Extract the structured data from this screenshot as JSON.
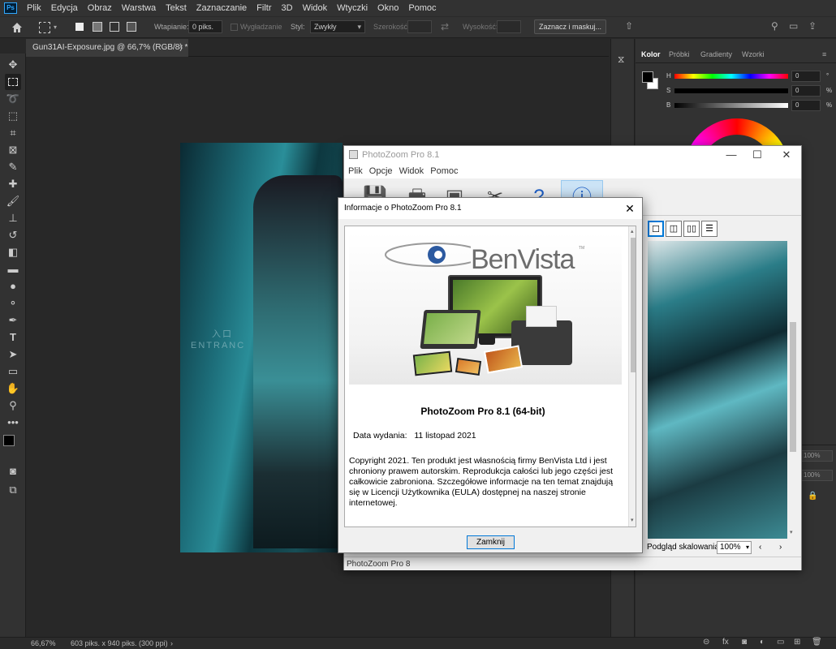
{
  "menubar": {
    "logo": "Ps",
    "items": [
      "Plik",
      "Edycja",
      "Obraz",
      "Warstwa",
      "Tekst",
      "Zaznaczanie",
      "Filtr",
      "3D",
      "Widok",
      "Wtyczki",
      "Okno",
      "Pomoc"
    ]
  },
  "options": {
    "feather_label": "Wtapianie:",
    "feather_value": "0 piks.",
    "antialias_label": "Wygładzanie",
    "style_label": "Styl:",
    "style_value": "Zwykły",
    "width_label": "Szerokość:",
    "height_label": "Wysokość:",
    "select_mask_button": "Zaznacz i maskuj..."
  },
  "document": {
    "tab_title": "Gun31AI-Exposure.jpg @ 66,7% (RGB/8) *",
    "close_glyph": "×",
    "entrance_top": "入口",
    "entrance_text": "ENTRANC"
  },
  "status": {
    "zoom": "66,67%",
    "doc_info": "603 piks. x 940 piks. (300 ppi)"
  },
  "color_panel": {
    "tabs": [
      "Kolor",
      "Próbki",
      "Gradienty",
      "Wzorki"
    ],
    "h_label": "H",
    "s_label": "S",
    "b_label": "B",
    "h_value": "0",
    "s_value": "0",
    "b_value": "0",
    "h_unit": "°",
    "s_unit": "%",
    "b_unit": "%"
  },
  "layers_panel": {
    "percent_a": "100%",
    "percent_b": "100%"
  },
  "photozoom": {
    "title": "PhotoZoom Pro 8.1",
    "menu": [
      "Plik",
      "Opcje",
      "Widok",
      "Pomoc"
    ],
    "preview_label": "Podgląd skalowania",
    "preview_zoom": "100%",
    "status": "PhotoZoom Pro 8"
  },
  "about": {
    "title": "Informacje o PhotoZoom Pro 8.1",
    "logo_text": "BenVista",
    "logo_tm": "TM",
    "product": "PhotoZoom Pro 8.1 (64-bit)",
    "release_label": "Data wydania:",
    "release_date": "11 listopad 2021",
    "copyright": "Copyright 2021. Ten produkt jest własnością firmy BenVista Ltd i jest chroniony prawem autorskim. Reprodukcja całości lub jego części jest całkowicie zabroniona. Szczegółowe informacje na ten temat znajdują się w Licencji Użytkownika (EULA) dostępnej na naszej stronie internetowej.",
    "close_button": "Zamknij"
  },
  "colors": {
    "ps_bg": "#323232",
    "ps_canvas": "#282828",
    "accent": "#0078d7"
  }
}
